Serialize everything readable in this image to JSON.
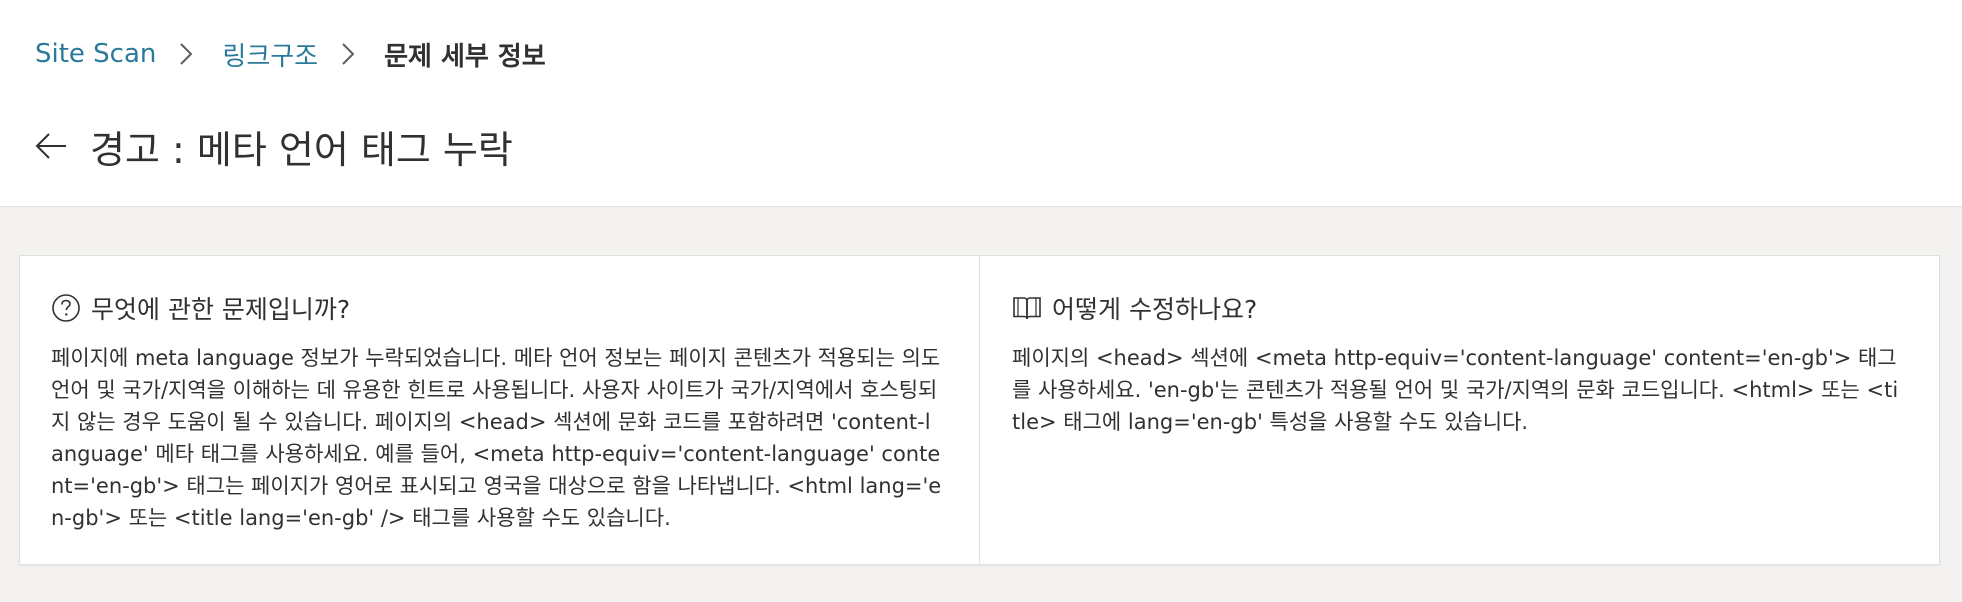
{
  "breadcrumb": {
    "items": [
      {
        "label": "Site Scan"
      },
      {
        "label": "링크구조"
      }
    ],
    "current": "문제 세부 정보"
  },
  "header": {
    "title": "경고 : 메타 언어 태그 누락"
  },
  "what": {
    "title": "무엇에 관한 문제입니까?",
    "body": "페이지에 meta language 정보가 누락되었습니다. 메타 언어 정보는 페이지 콘텐츠가 적용되는 의도 언어 및 국가/지역을 이해하는 데 유용한 힌트로 사용됩니다. 사용자 사이트가 국가/지역에서 호스팅되지 않는 경우 도움이 될 수 있습니다. 페이지의 <head> 섹션에 문화 코드를 포함하려면 'content-language' 메타 태그를 사용하세요. 예를 들어, <meta http-equiv='content-language' content='en-gb'> 태그는 페이지가 영어로 표시되고 영국을 대상으로 함을 나타냅니다. <html lang='en-gb'> 또는 <title lang='en-gb' /> 태그를 사용할 수도 있습니다."
  },
  "how": {
    "title": "어떻게 수정하나요?",
    "body": "페이지의 <head> 섹션에 <meta http-equiv='content-language' content='en-gb'> 태그를 사용하세요. 'en-gb'는 콘텐츠가 적용될 언어 및 국가/지역의 문화 코드입니다. <html> 또는 <title> 태그에 lang='en-gb' 특성을 사용할 수도 있습니다."
  },
  "icons": {
    "back": "arrow-left-icon",
    "separator": "chevron-right-icon",
    "what": "question-circle-icon",
    "how": "open-book-icon"
  },
  "colors": {
    "link": "#2b7a9b",
    "text": "#323130",
    "background": "#f3f2f1"
  }
}
